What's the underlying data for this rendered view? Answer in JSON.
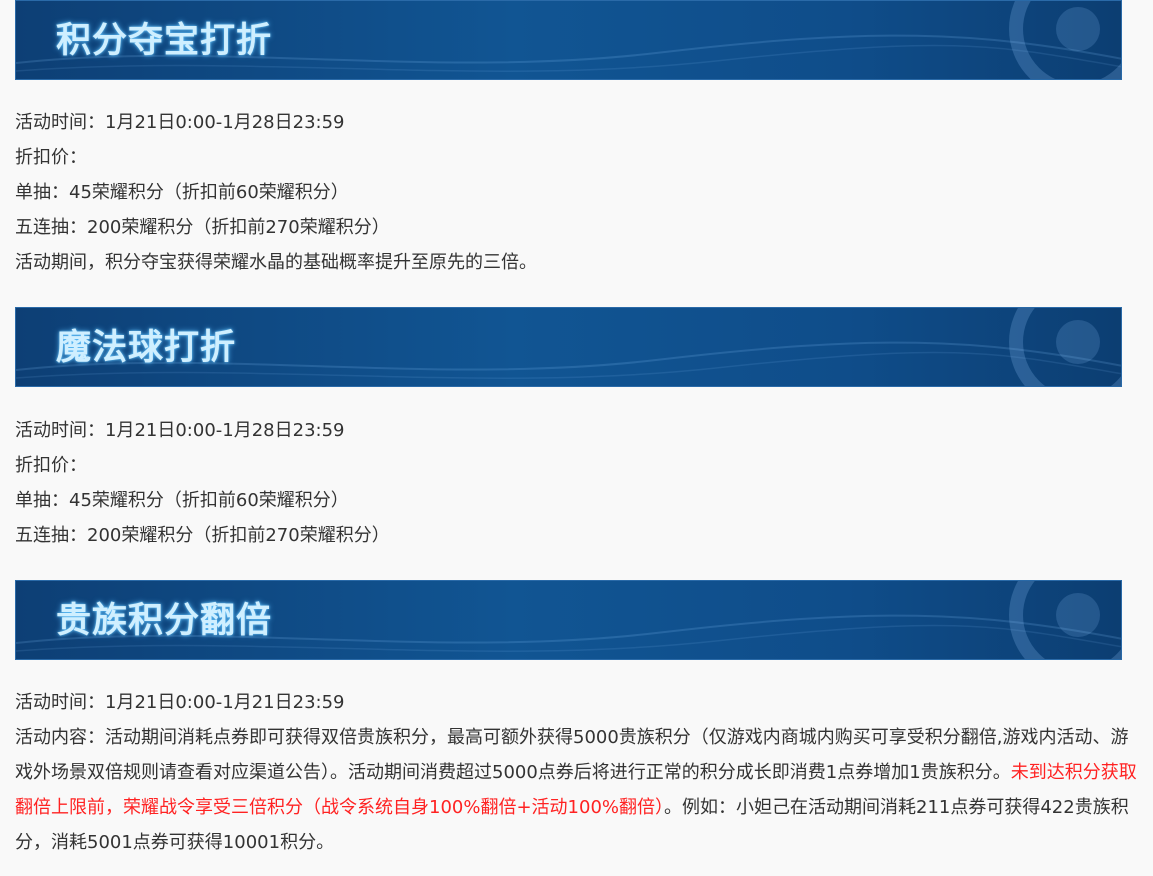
{
  "sections": [
    {
      "title": "积分夺宝打折",
      "lines": [
        "活动时间：1月21日0:00-1月28日23:59",
        "折扣价：",
        "单抽：45荣耀积分（折扣前60荣耀积分）",
        "五连抽：200荣耀积分（折扣前270荣耀积分）",
        "活动期间，积分夺宝获得荣耀水晶的基础概率提升至原先的三倍。"
      ]
    },
    {
      "title": "魔法球打折",
      "lines": [
        "活动时间：1月21日0:00-1月28日23:59",
        "折扣价：",
        "单抽：45荣耀积分（折扣前60荣耀积分）",
        "五连抽：200荣耀积分（折扣前270荣耀积分）"
      ]
    },
    {
      "title": "贵族积分翻倍",
      "time_line": "活动时间：1月21日0:00-1月21日23:59",
      "content_part1": "活动内容：活动期间消耗点券即可获得双倍贵族积分，最高可额外获得5000贵族积分（仅游戏内商城内购买可享受积分翻倍,游戏内活动、游戏外场景双倍规则请查看对应渠道公告）。活动期间消费超过5000点券后将进行正常的积分成长即消费1点券增加1贵族积分。",
      "content_highlight": "未到达积分获取翻倍上限前，荣耀战令享受三倍积分（战令系统自身100%翻倍+活动100%翻倍）",
      "content_part2": "。例如：小妲己在活动期间消耗211点券可获得422贵族积分，消耗5001点券可获得10001积分。"
    }
  ],
  "colors": {
    "banner": "#115593",
    "title_glow": "#cfefff",
    "highlight": "#ff2222",
    "text": "#333333"
  }
}
